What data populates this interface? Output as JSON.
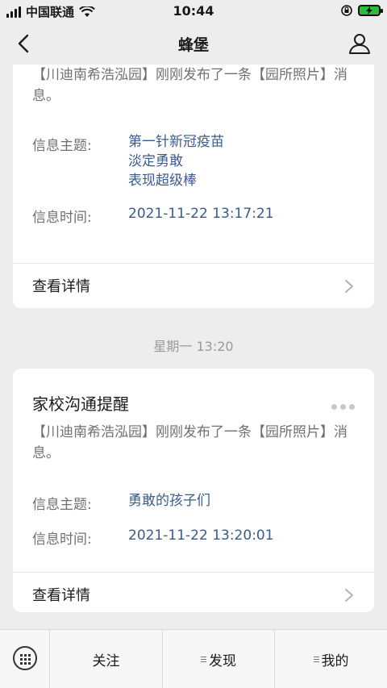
{
  "status_bar": {
    "carrier": "中国联通",
    "time": "10:44"
  },
  "nav": {
    "title": "蜂堡"
  },
  "cards": [
    {
      "desc": "【川迪南希浩泓园】刚刚发布了一条【园所照片】消息。",
      "topic_label": "信息主题:",
      "topic_lines": [
        "第一针新冠疫苗",
        "淡定勇敢",
        "表现超级棒"
      ],
      "time_label": "信息时间:",
      "time_value": "2021-11-22 13:17:21",
      "detail_label": "查看详情"
    },
    {
      "title": "家校沟通提醒",
      "desc": "【川迪南希浩泓园】刚刚发布了一条【园所照片】消息。",
      "topic_label": "信息主题:",
      "topic_value": "勇敢的孩子们",
      "time_label": "信息时间:",
      "time_value": "2021-11-22 13:20:01",
      "detail_label": "查看详情"
    }
  ],
  "time_separator": "星期一 13:20",
  "tab_bar": {
    "items": [
      {
        "label": "关注"
      },
      {
        "label": "发现"
      },
      {
        "label": "我的"
      }
    ]
  },
  "colors": {
    "accent_link": "#3b5b8a",
    "battery": "#2dbb3b"
  }
}
